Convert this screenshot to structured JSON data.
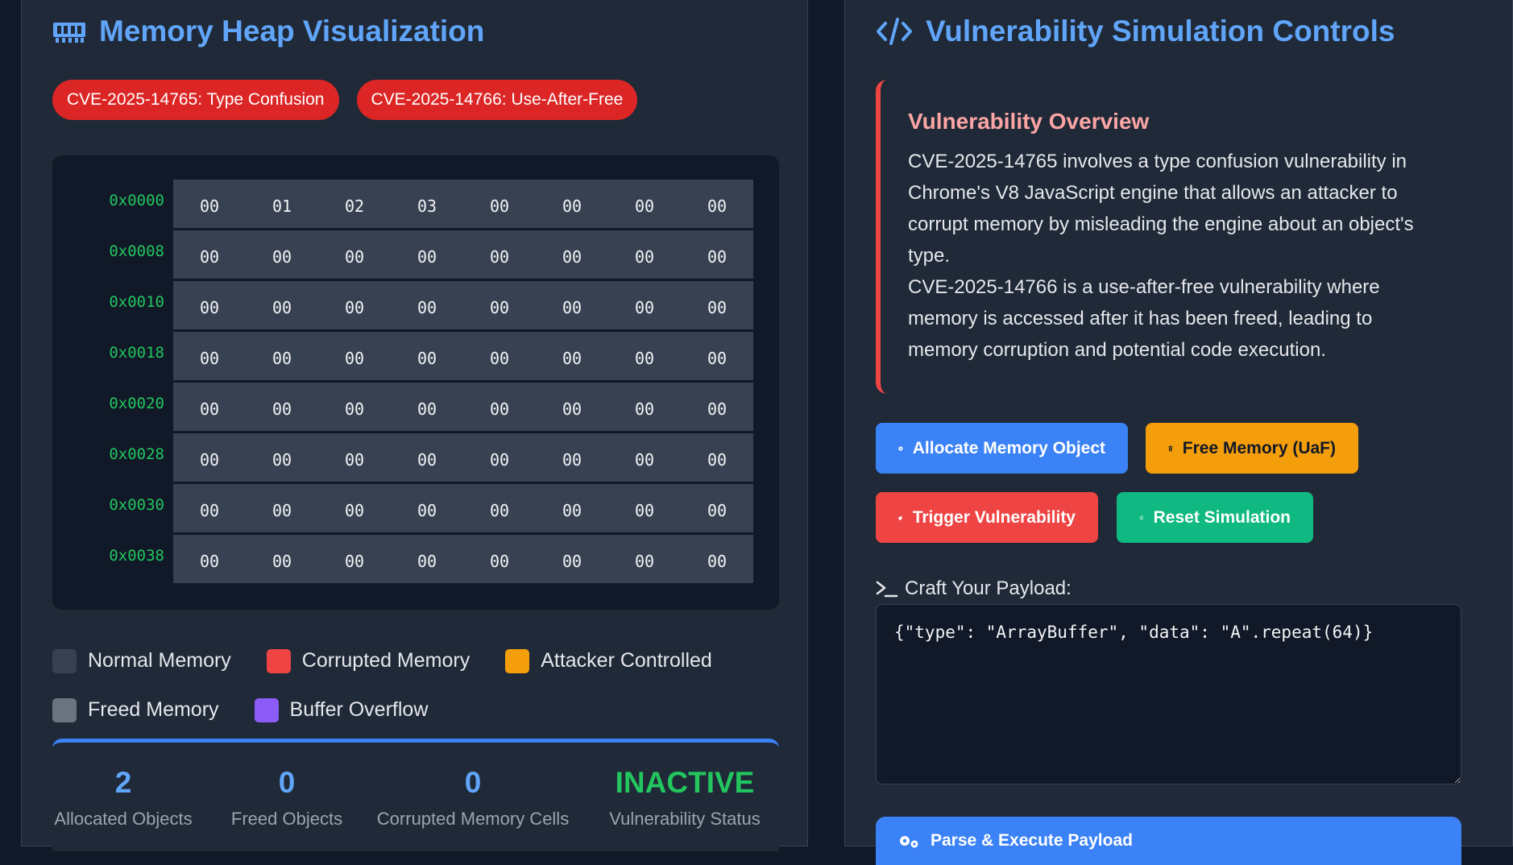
{
  "left": {
    "title": "Memory Heap Visualization",
    "cve_tags": [
      "CVE-2025-14765: Type Confusion",
      "CVE-2025-14766: Use-After-Free"
    ],
    "heap": {
      "rows": [
        {
          "address": "0x0000",
          "cells": [
            "00",
            "01",
            "02",
            "03",
            "00",
            "00",
            "00",
            "00"
          ]
        },
        {
          "address": "0x0008",
          "cells": [
            "00",
            "00",
            "00",
            "00",
            "00",
            "00",
            "00",
            "00"
          ]
        },
        {
          "address": "0x0010",
          "cells": [
            "00",
            "00",
            "00",
            "00",
            "00",
            "00",
            "00",
            "00"
          ]
        },
        {
          "address": "0x0018",
          "cells": [
            "00",
            "00",
            "00",
            "00",
            "00",
            "00",
            "00",
            "00"
          ]
        },
        {
          "address": "0x0020",
          "cells": [
            "00",
            "00",
            "00",
            "00",
            "00",
            "00",
            "00",
            "00"
          ]
        },
        {
          "address": "0x0028",
          "cells": [
            "00",
            "00",
            "00",
            "00",
            "00",
            "00",
            "00",
            "00"
          ]
        },
        {
          "address": "0x0030",
          "cells": [
            "00",
            "00",
            "00",
            "00",
            "00",
            "00",
            "00",
            "00"
          ]
        },
        {
          "address": "0x0038",
          "cells": [
            "00",
            "00",
            "00",
            "00",
            "00",
            "00",
            "00",
            "00"
          ]
        }
      ]
    },
    "legend": [
      {
        "label": "Normal Memory",
        "color": "#374151"
      },
      {
        "label": "Corrupted Memory",
        "color": "#ef4444"
      },
      {
        "label": "Attacker Controlled",
        "color": "#f59e0b"
      },
      {
        "label": "Freed Memory",
        "color": "#6b7280"
      },
      {
        "label": "Buffer Overflow",
        "color": "#8b5cf6"
      }
    ],
    "stats": [
      {
        "value": "2",
        "label": "Allocated Objects"
      },
      {
        "value": "0",
        "label": "Freed Objects"
      },
      {
        "value": "0",
        "label": "Corrupted Memory Cells"
      },
      {
        "value": "INACTIVE",
        "label": "Vulnerability Status"
      }
    ]
  },
  "right": {
    "title": "Vulnerability Simulation Controls",
    "overview": {
      "heading": "Vulnerability Overview",
      "paragraph1": "CVE-2025-14765 involves a type confusion vulnerability in Chrome's V8 JavaScript engine that allows an attacker to corrupt memory by misleading the engine about an object's type.",
      "paragraph2": "CVE-2025-14766 is a use-after-free vulnerability where memory is accessed after it has been freed, leading to memory corruption and potential code execution."
    },
    "buttons": {
      "allocate": "Allocate Memory Object",
      "free": "Free Memory (UaF)",
      "trigger": "Trigger Vulnerability",
      "reset": "Reset Simulation",
      "execute": "Parse & Execute Payload"
    },
    "payload": {
      "label": "Craft Your Payload:",
      "value": "{\"type\": \"ArrayBuffer\", \"data\": \"A\".repeat(64)}"
    }
  },
  "colors": {
    "accent": "#60a5fa",
    "danger": "#ef4444",
    "warning": "#f59e0b",
    "success": "#10b981",
    "address": "#22c55e"
  },
  "icons": [
    "memory-icon",
    "code-icon",
    "plus-circle-icon",
    "trash-icon",
    "bomb-icon",
    "rotate-icon",
    "terminal-icon",
    "gears-icon"
  ]
}
